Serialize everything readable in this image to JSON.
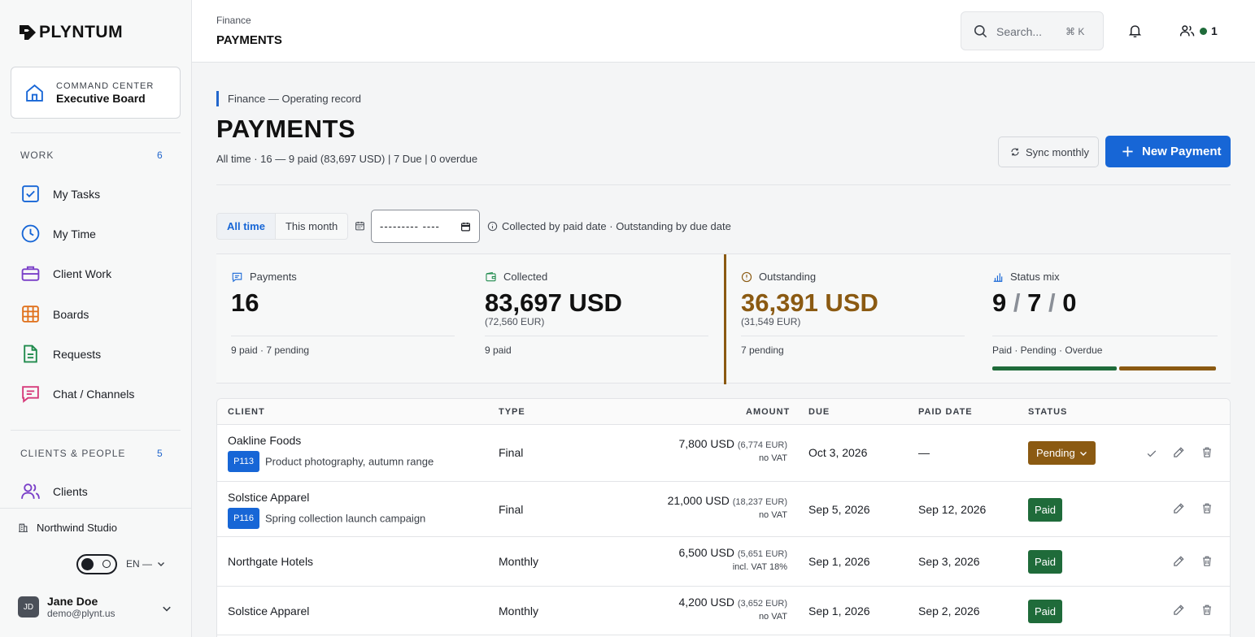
{
  "brand": {
    "name": "PLYNTUM"
  },
  "command_center": {
    "eyebrow": "COMMAND CENTER",
    "title": "Executive Board"
  },
  "sidebar": {
    "work": {
      "label": "WORK",
      "count": "6",
      "items": [
        {
          "label": "My Tasks",
          "icon": "checkbox-icon"
        },
        {
          "label": "My Time",
          "icon": "clock-icon"
        },
        {
          "label": "Client Work",
          "icon": "briefcase-icon"
        },
        {
          "label": "Boards",
          "icon": "board-icon"
        },
        {
          "label": "Requests",
          "icon": "document-icon"
        },
        {
          "label": "Chat / Channels",
          "icon": "chat-icon"
        }
      ]
    },
    "clients": {
      "label": "CLIENTS & PEOPLE",
      "count": "5",
      "items": [
        {
          "label": "Clients",
          "icon": "users-icon"
        }
      ]
    },
    "org": "Northwind Studio",
    "lang": "EN —",
    "user": {
      "initials": "JD",
      "name": "Jane Doe",
      "email": "demo@plynt.us"
    }
  },
  "topbar": {
    "crumb": "Finance",
    "title": "PAYMENTS",
    "search_placeholder": "Search...",
    "search_shortcut": "⌘ K",
    "online_count": "1"
  },
  "page": {
    "eyebrow": "Finance — Operating record",
    "title": "PAYMENTS",
    "summary": "All time · 16 — 9 paid (83,697 USD) | 7 Due | 0 overdue",
    "sync_label": "Sync monthly",
    "new_label": "New Payment",
    "filters": {
      "all_time": "All time",
      "this_month": "This month",
      "date_value": "--------- ----"
    },
    "hint": "Collected by paid date · Outstanding by due date"
  },
  "stats": {
    "payments": {
      "label": "Payments",
      "value": "16",
      "foot": "9 paid · 7 pending"
    },
    "collected": {
      "label": "Collected",
      "value": "83,697 USD",
      "sub": "(72,560 EUR)",
      "foot": "9 paid"
    },
    "outstanding": {
      "label": "Outstanding",
      "value": "36,391 USD",
      "sub": "(31,549 EUR)",
      "foot": "7 pending"
    },
    "status_mix": {
      "label": "Status mix",
      "paid": "9",
      "pending": "7",
      "overdue": "0",
      "sep": "/",
      "foot": "Paid · Pending · Overdue",
      "paid_share": 0.5625,
      "pending_share": 0.4375
    },
    "colors": {
      "paid": "#1f6b3a",
      "pending": "#8b5a12",
      "accent": "#1766d6"
    }
  },
  "table": {
    "headers": {
      "client": "CLIENT",
      "type": "TYPE",
      "amount": "AMOUNT",
      "due": "DUE",
      "paid_date": "PAID DATE",
      "status": "STATUS"
    },
    "rows": [
      {
        "client": "Oakline Foods",
        "pid": "P113",
        "desc": "Product photography, autumn range",
        "type": "Final",
        "amount": "7,800 USD",
        "eq": "(6,774 EUR)",
        "vat": "no VAT",
        "due": "Oct 3, 2026",
        "paid": "—",
        "status": "Pending"
      },
      {
        "client": "Solstice Apparel",
        "pid": "P116",
        "desc": "Spring collection launch campaign",
        "type": "Final",
        "amount": "21,000 USD",
        "eq": "(18,237 EUR)",
        "vat": "no VAT",
        "due": "Sep 5, 2026",
        "paid": "Sep 12, 2026",
        "status": "Paid"
      },
      {
        "client": "Northgate Hotels",
        "type": "Monthly",
        "amount": "6,500 USD",
        "eq": "(5,651 EUR)",
        "vat": "incl. VAT 18%",
        "due": "Sep 1, 2026",
        "paid": "Sep 3, 2026",
        "status": "Paid"
      },
      {
        "client": "Solstice Apparel",
        "type": "Monthly",
        "amount": "4,200 USD",
        "eq": "(3,652 EUR)",
        "vat": "no VAT",
        "due": "Sep 1, 2026",
        "paid": "Sep 2, 2026",
        "status": "Paid"
      }
    ]
  }
}
